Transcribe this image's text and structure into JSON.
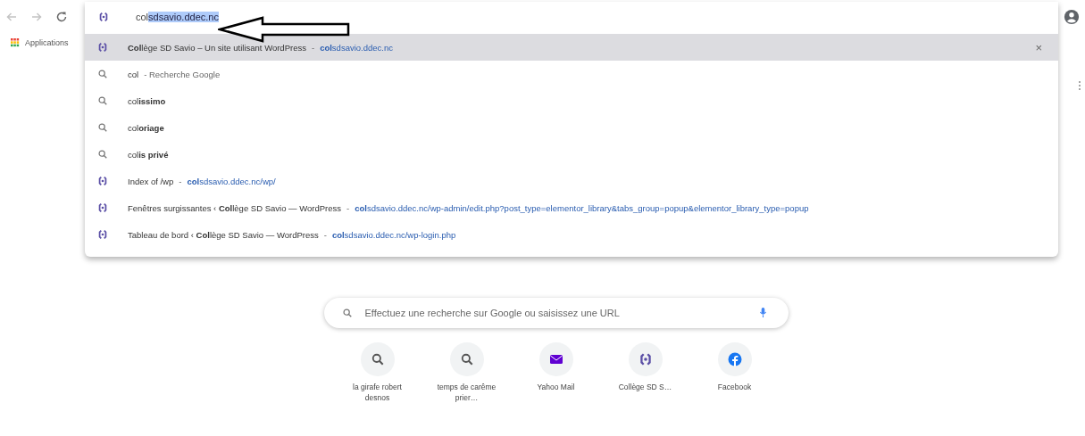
{
  "omnibox": {
    "typed": "col",
    "autocomplete": "sdsavio.ddec.nc"
  },
  "bookmarks": [
    {
      "label": "Applications",
      "kind": "apps"
    }
  ],
  "suggestions": [
    {
      "kind": "site",
      "text": "**Col**lège SD Savio – Un site utilisant WordPress",
      "sep": "-",
      "url": "**col**sdsavio.ddec.nc",
      "selected": true,
      "remove": "×"
    },
    {
      "kind": "search",
      "text": "col",
      "hint": "- Recherche Google",
      "selected": false
    },
    {
      "kind": "search",
      "text": "col**issimo**",
      "selected": false
    },
    {
      "kind": "search",
      "text": "col**oriage**",
      "selected": false
    },
    {
      "kind": "search",
      "text": "col**is privé**",
      "selected": false
    },
    {
      "kind": "site",
      "text": "Index of /wp",
      "sep": "-",
      "url": "**col**sdsavio.ddec.nc/wp/",
      "selected": false
    },
    {
      "kind": "site",
      "text": "Fenêtres surgissantes ‹ **Col**lège SD Savio — WordPress",
      "sep": "-",
      "url": "**col**sdsavio.ddec.nc/wp-admin/edit.php?post_type=elementor_library&tabs_group=popup&elementor_library_type=popup",
      "selected": false
    },
    {
      "kind": "site",
      "text": "Tableau de bord ‹ **Col**lège SD Savio — WordPress",
      "sep": "-",
      "url": "**col**sdsavio.ddec.nc/wp-login.php",
      "selected": false
    }
  ],
  "search": {
    "placeholder": "Effectuez une recherche sur Google ou saisissez une URL"
  },
  "shortcuts": [
    {
      "label": "la girafe robert desnos",
      "kind": "search"
    },
    {
      "label": "temps de carême prier…",
      "kind": "search"
    },
    {
      "label": "Yahoo Mail",
      "kind": "mail"
    },
    {
      "label": "Collège SD S…",
      "kind": "site"
    },
    {
      "label": "Facebook",
      "kind": "facebook"
    }
  ]
}
